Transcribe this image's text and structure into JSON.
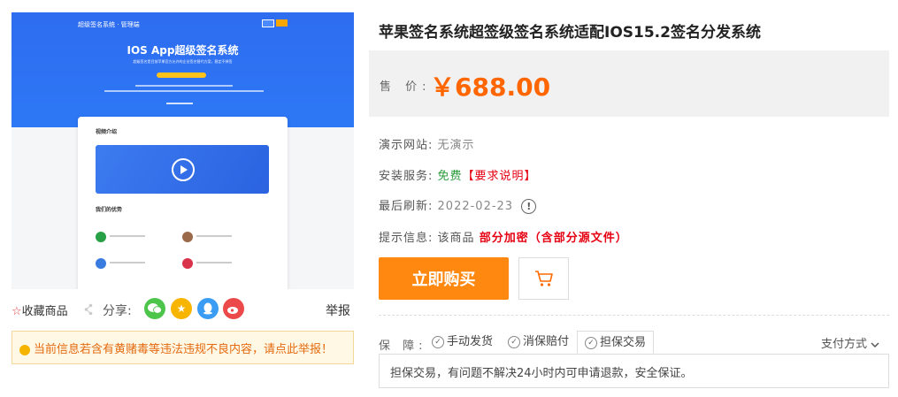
{
  "preview": {
    "brand": "超级签名系统 · 管理端",
    "headline": "IOS App超级签名系统",
    "subline": "超级签名是目前苹果官方允许的企业签名替代方案，稳定不掉签",
    "section_video": "视频介绍",
    "section_adv": "我们的优势"
  },
  "product": {
    "title": "苹果签名系统超签级签名系统适配IOS15.2签名分发系统",
    "price_label": "售 价:",
    "price": "￥688.00",
    "demo_label": "演示网站:",
    "demo_value": "无演示",
    "install_label": "安装服务:",
    "install_free": "免费",
    "install_note": "【要求说明】",
    "refresh_label": "最后刷新:",
    "refresh_value": "2022-02-23",
    "tip_label": "提示信息:",
    "tip_prefix": "该商品",
    "tip_value": "部分加密（含部分源文件）",
    "buy_label": "立即购买",
    "cart_icon": "cart-icon"
  },
  "guarantee": {
    "label": "保 障:",
    "tabs": [
      "手动发货",
      "消保赔付",
      "担保交易"
    ],
    "active_tab": "担保交易",
    "pay_method": "支付方式",
    "content": "担保交易，有问题不解决24小时内可申请退款，安全保证。"
  },
  "left_actions": {
    "favorite": "收藏商品",
    "share": "分享:",
    "report": "举报",
    "notice": "当前信息若含有黄赌毒等违法违规不良内容，请点此举报！"
  },
  "colors": {
    "price": "#ff6600",
    "buy_button": "#ff8811",
    "free": "#2a9a3a",
    "warn": "#e60012"
  }
}
